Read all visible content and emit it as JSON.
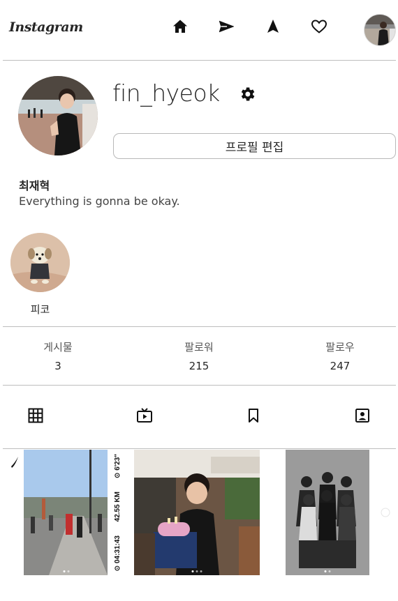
{
  "header": {
    "logo": "Instagram",
    "nav": [
      "home-icon",
      "direct-icon",
      "explore-icon",
      "activity-icon"
    ]
  },
  "profile": {
    "username": "fin_hyeok",
    "edit_label": "프로필 편집",
    "full_name": "최재혁",
    "bio": "Everything is gonna be okay."
  },
  "highlights": [
    {
      "label": "피코"
    }
  ],
  "stats": [
    {
      "label": "게시물",
      "value": "3"
    },
    {
      "label": "팔로워",
      "value": "215"
    },
    {
      "label": "팔로우",
      "value": "247"
    }
  ],
  "tabs": [
    "grid-icon",
    "igtv-icon",
    "saved-icon",
    "tagged-icon"
  ],
  "posts": [
    {
      "side_text_1": "⊙ 6'23\"",
      "side_text_2": "42.55 KM",
      "side_text_3": "⊙ 04:31:43"
    },
    {},
    {}
  ]
}
